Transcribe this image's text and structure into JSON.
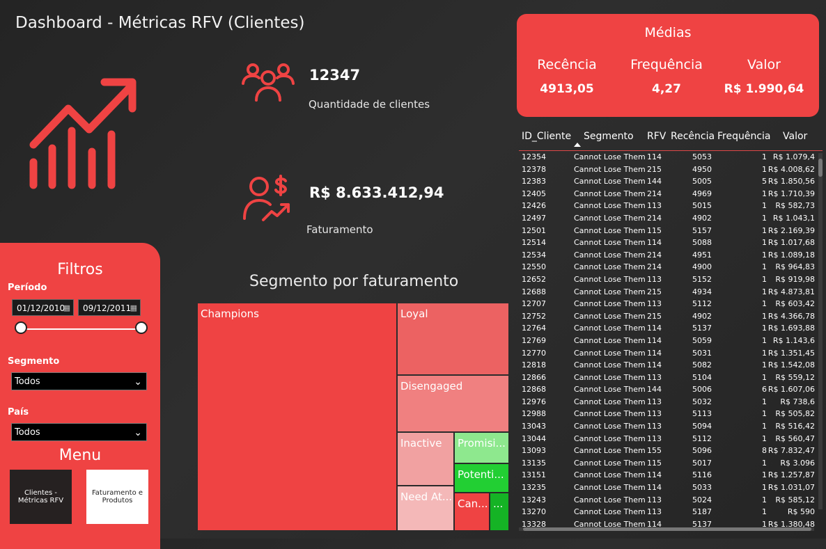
{
  "title": "Dashboard - Métricas RFV (Clientes)",
  "colors": {
    "accent": "#ef4343",
    "background": "#2a2a2a"
  },
  "kpis": {
    "clientes": {
      "value": "12347",
      "label": "Quantidade de clientes",
      "icon": "users-group-icon"
    },
    "faturamento": {
      "value": "R$ 8.633.412,94",
      "label": "Faturamento",
      "icon": "user-dollar-growth-icon"
    }
  },
  "medias": {
    "title": "Médias",
    "recencia": {
      "label": "Recência",
      "value": "4913,05"
    },
    "frequencia": {
      "label": "Frequência",
      "value": "4,27"
    },
    "valor": {
      "label": "Valor",
      "value": "R$ 1.990,64"
    }
  },
  "filters": {
    "title": "Filtros",
    "periodo": {
      "label": "Período",
      "start": "01/12/2010",
      "end": "09/12/2011"
    },
    "segmento": {
      "label": "Segmento",
      "selected": "Todos"
    },
    "pais": {
      "label": "País",
      "selected": "Todos"
    }
  },
  "menu": {
    "title": "Menu",
    "buttons": [
      {
        "label": "Clientes - Métricas RFV"
      },
      {
        "label": "Faturamento e Produtos"
      }
    ]
  },
  "treemap": {
    "title": "Segmento por faturamento",
    "tiles": [
      {
        "label": "Champions",
        "color": "#ef4343"
      },
      {
        "label": "Loyal",
        "color": "#ec6262"
      },
      {
        "label": "Disengaged",
        "color": "#f08080"
      },
      {
        "label": "Inactive",
        "color": "#f1a1a1"
      },
      {
        "label": "Need At...",
        "color": "#f4b8b8"
      },
      {
        "label": "Promisi...",
        "color": "#8ee88e"
      },
      {
        "label": "Potenti...",
        "color": "#22cf33"
      },
      {
        "label": "Can...",
        "color": "#ef4343"
      },
      {
        "label": "...",
        "color": "#15b325"
      }
    ]
  },
  "table": {
    "headers": {
      "id": "ID_Cliente",
      "segmento": "Segmento",
      "rfv": "RFV",
      "recencia": "Recência",
      "frequencia": "Frequência",
      "valor": "Valor"
    },
    "rows": [
      [
        "12354",
        "Cannot Lose Them",
        "114",
        "5053",
        "1",
        "R$ 1.079,4"
      ],
      [
        "12378",
        "Cannot Lose Them",
        "215",
        "4950",
        "1",
        "R$ 4.008,62"
      ],
      [
        "12383",
        "Cannot Lose Them",
        "144",
        "5005",
        "5",
        "R$ 1.850,56"
      ],
      [
        "12405",
        "Cannot Lose Them",
        "214",
        "4969",
        "1",
        "R$ 1.710,39"
      ],
      [
        "12426",
        "Cannot Lose Them",
        "113",
        "5015",
        "1",
        "R$ 582,73"
      ],
      [
        "12497",
        "Cannot Lose Them",
        "214",
        "4902",
        "1",
        "R$ 1.043,1"
      ],
      [
        "12501",
        "Cannot Lose Them",
        "115",
        "5157",
        "1",
        "R$ 2.169,39"
      ],
      [
        "12514",
        "Cannot Lose Them",
        "114",
        "5088",
        "1",
        "R$ 1.017,68"
      ],
      [
        "12534",
        "Cannot Lose Them",
        "214",
        "4951",
        "1",
        "R$ 1.089,18"
      ],
      [
        "12550",
        "Cannot Lose Them",
        "214",
        "4900",
        "1",
        "R$ 964,83"
      ],
      [
        "12652",
        "Cannot Lose Them",
        "113",
        "5152",
        "1",
        "R$ 919,98"
      ],
      [
        "12688",
        "Cannot Lose Them",
        "215",
        "4934",
        "1",
        "R$ 4.873,81"
      ],
      [
        "12707",
        "Cannot Lose Them",
        "113",
        "5112",
        "1",
        "R$ 603,42"
      ],
      [
        "12752",
        "Cannot Lose Them",
        "215",
        "4902",
        "1",
        "R$ 4.366,78"
      ],
      [
        "12764",
        "Cannot Lose Them",
        "114",
        "5137",
        "1",
        "R$ 1.693,88"
      ],
      [
        "12769",
        "Cannot Lose Them",
        "114",
        "5059",
        "1",
        "R$ 1.143,6"
      ],
      [
        "12770",
        "Cannot Lose Them",
        "114",
        "5031",
        "1",
        "R$ 1.351,45"
      ],
      [
        "12818",
        "Cannot Lose Them",
        "114",
        "5082",
        "1",
        "R$ 1.542,08"
      ],
      [
        "12866",
        "Cannot Lose Them",
        "113",
        "5104",
        "1",
        "R$ 559,12"
      ],
      [
        "12868",
        "Cannot Lose Them",
        "144",
        "5006",
        "6",
        "R$ 1.607,06"
      ],
      [
        "12976",
        "Cannot Lose Them",
        "113",
        "5032",
        "1",
        "R$ 738,6"
      ],
      [
        "12988",
        "Cannot Lose Them",
        "113",
        "5113",
        "1",
        "R$ 505,82"
      ],
      [
        "13043",
        "Cannot Lose Them",
        "113",
        "5094",
        "1",
        "R$ 516,42"
      ],
      [
        "13044",
        "Cannot Lose Them",
        "113",
        "5112",
        "1",
        "R$ 560,47"
      ],
      [
        "13093",
        "Cannot Lose Them",
        "155",
        "5096",
        "8",
        "R$ 7.832,47"
      ],
      [
        "13135",
        "Cannot Lose Them",
        "115",
        "5017",
        "1",
        "R$ 3.096"
      ],
      [
        "13151",
        "Cannot Lose Them",
        "114",
        "5116",
        "1",
        "R$ 1.257,87"
      ],
      [
        "13235",
        "Cannot Lose Them",
        "114",
        "5033",
        "1",
        "R$ 1.031,07"
      ],
      [
        "13243",
        "Cannot Lose Them",
        "113",
        "5024",
        "1",
        "R$ 585,12"
      ],
      [
        "13270",
        "Cannot Lose Them",
        "113",
        "5187",
        "1",
        "R$ 590"
      ],
      [
        "13328",
        "Cannot Lose Them",
        "114",
        "5137",
        "1",
        "R$ 1.380,48"
      ]
    ]
  }
}
